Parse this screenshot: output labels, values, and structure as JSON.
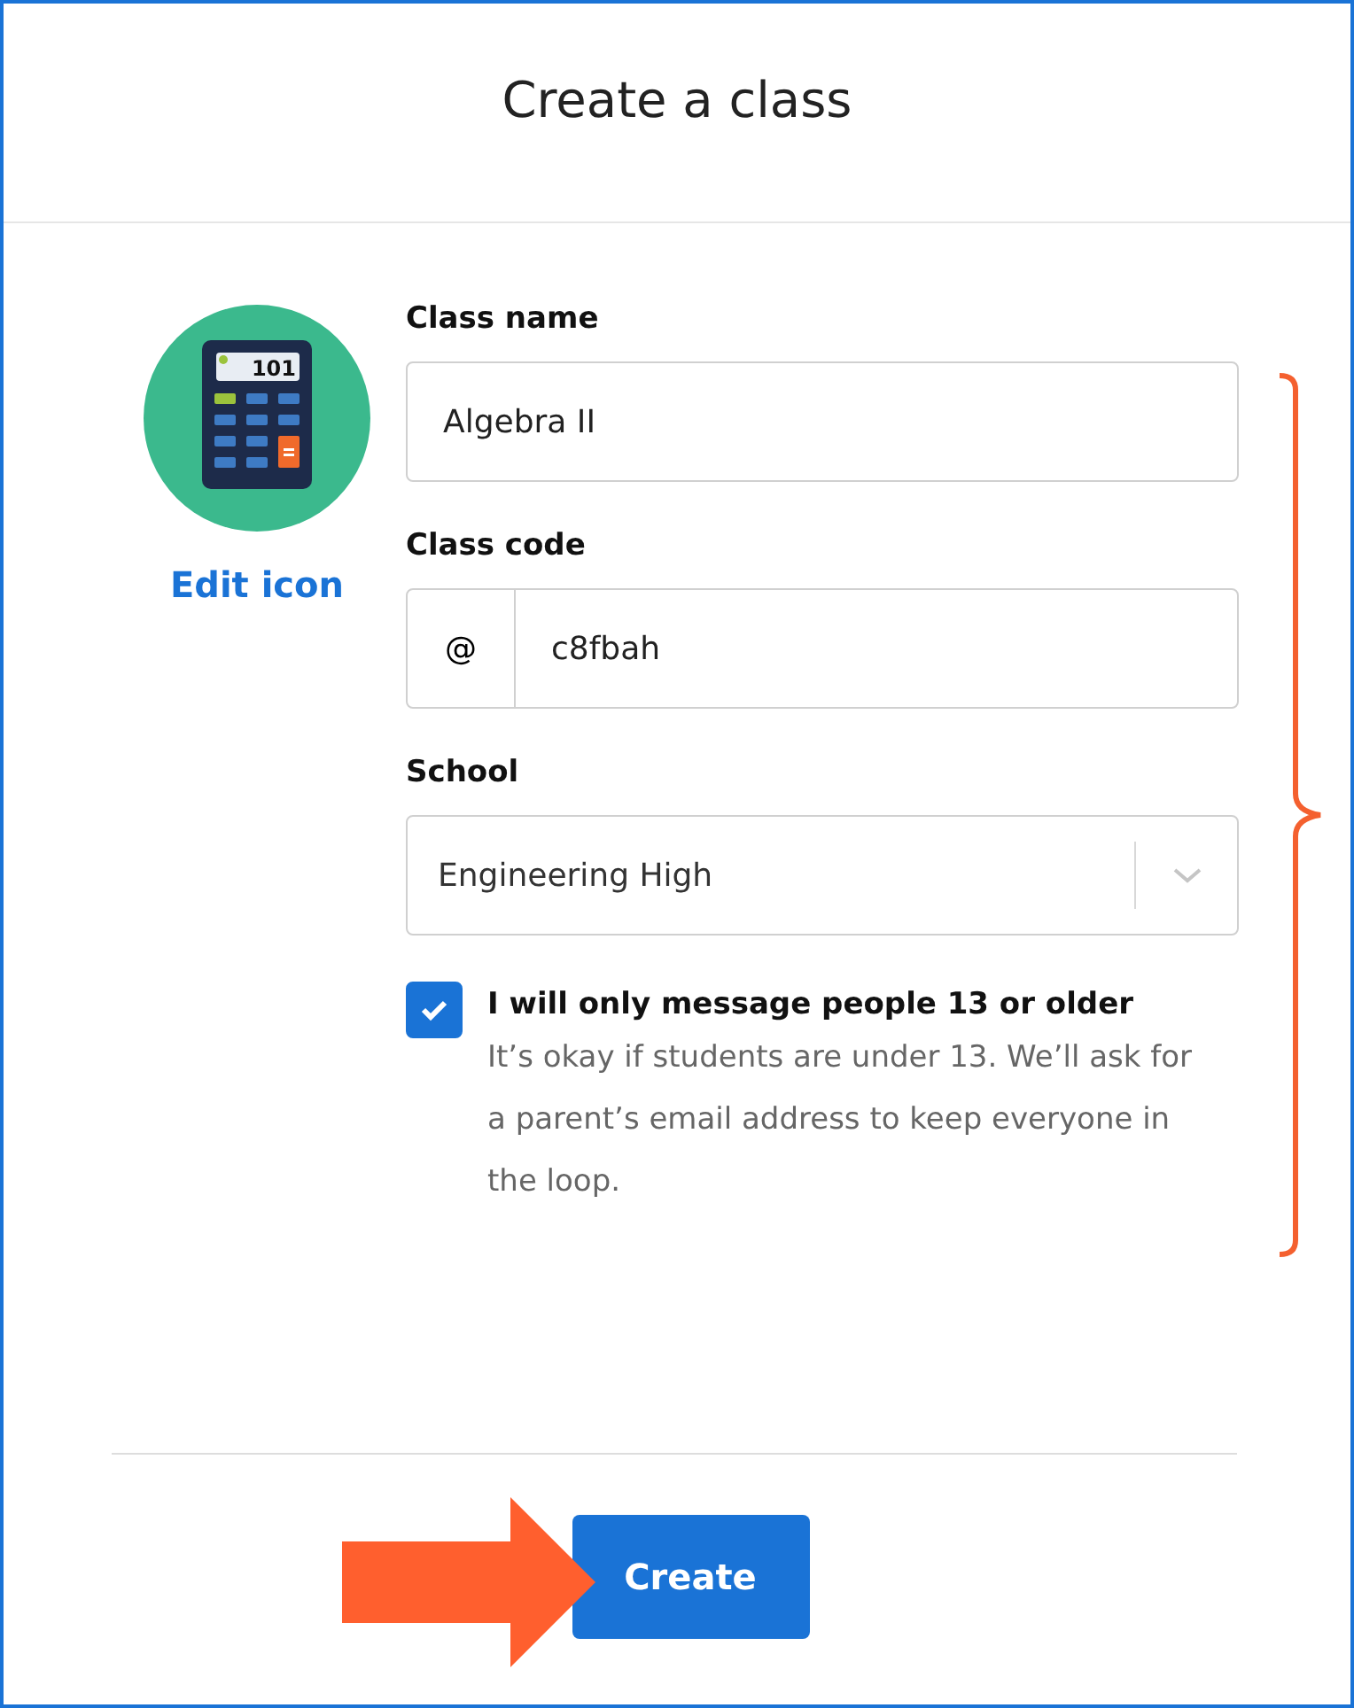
{
  "title": "Create a class",
  "class_icon": {
    "display": "101",
    "edit_label": "Edit icon"
  },
  "fields": [
    {
      "kind": "text",
      "label": "Class name",
      "value": "Algebra II"
    },
    {
      "kind": "prefixed",
      "label": "Class code",
      "prefix": "@",
      "value": "c8fbah"
    },
    {
      "kind": "select",
      "label": "School",
      "value": "Engineering High"
    }
  ],
  "consent": {
    "checked": true,
    "label": "I will only message people 13 or older",
    "description": "It’s okay if students are under 13. We’ll ask for a parent’s email address to keep everyone in the loop."
  },
  "create_button": "Create"
}
